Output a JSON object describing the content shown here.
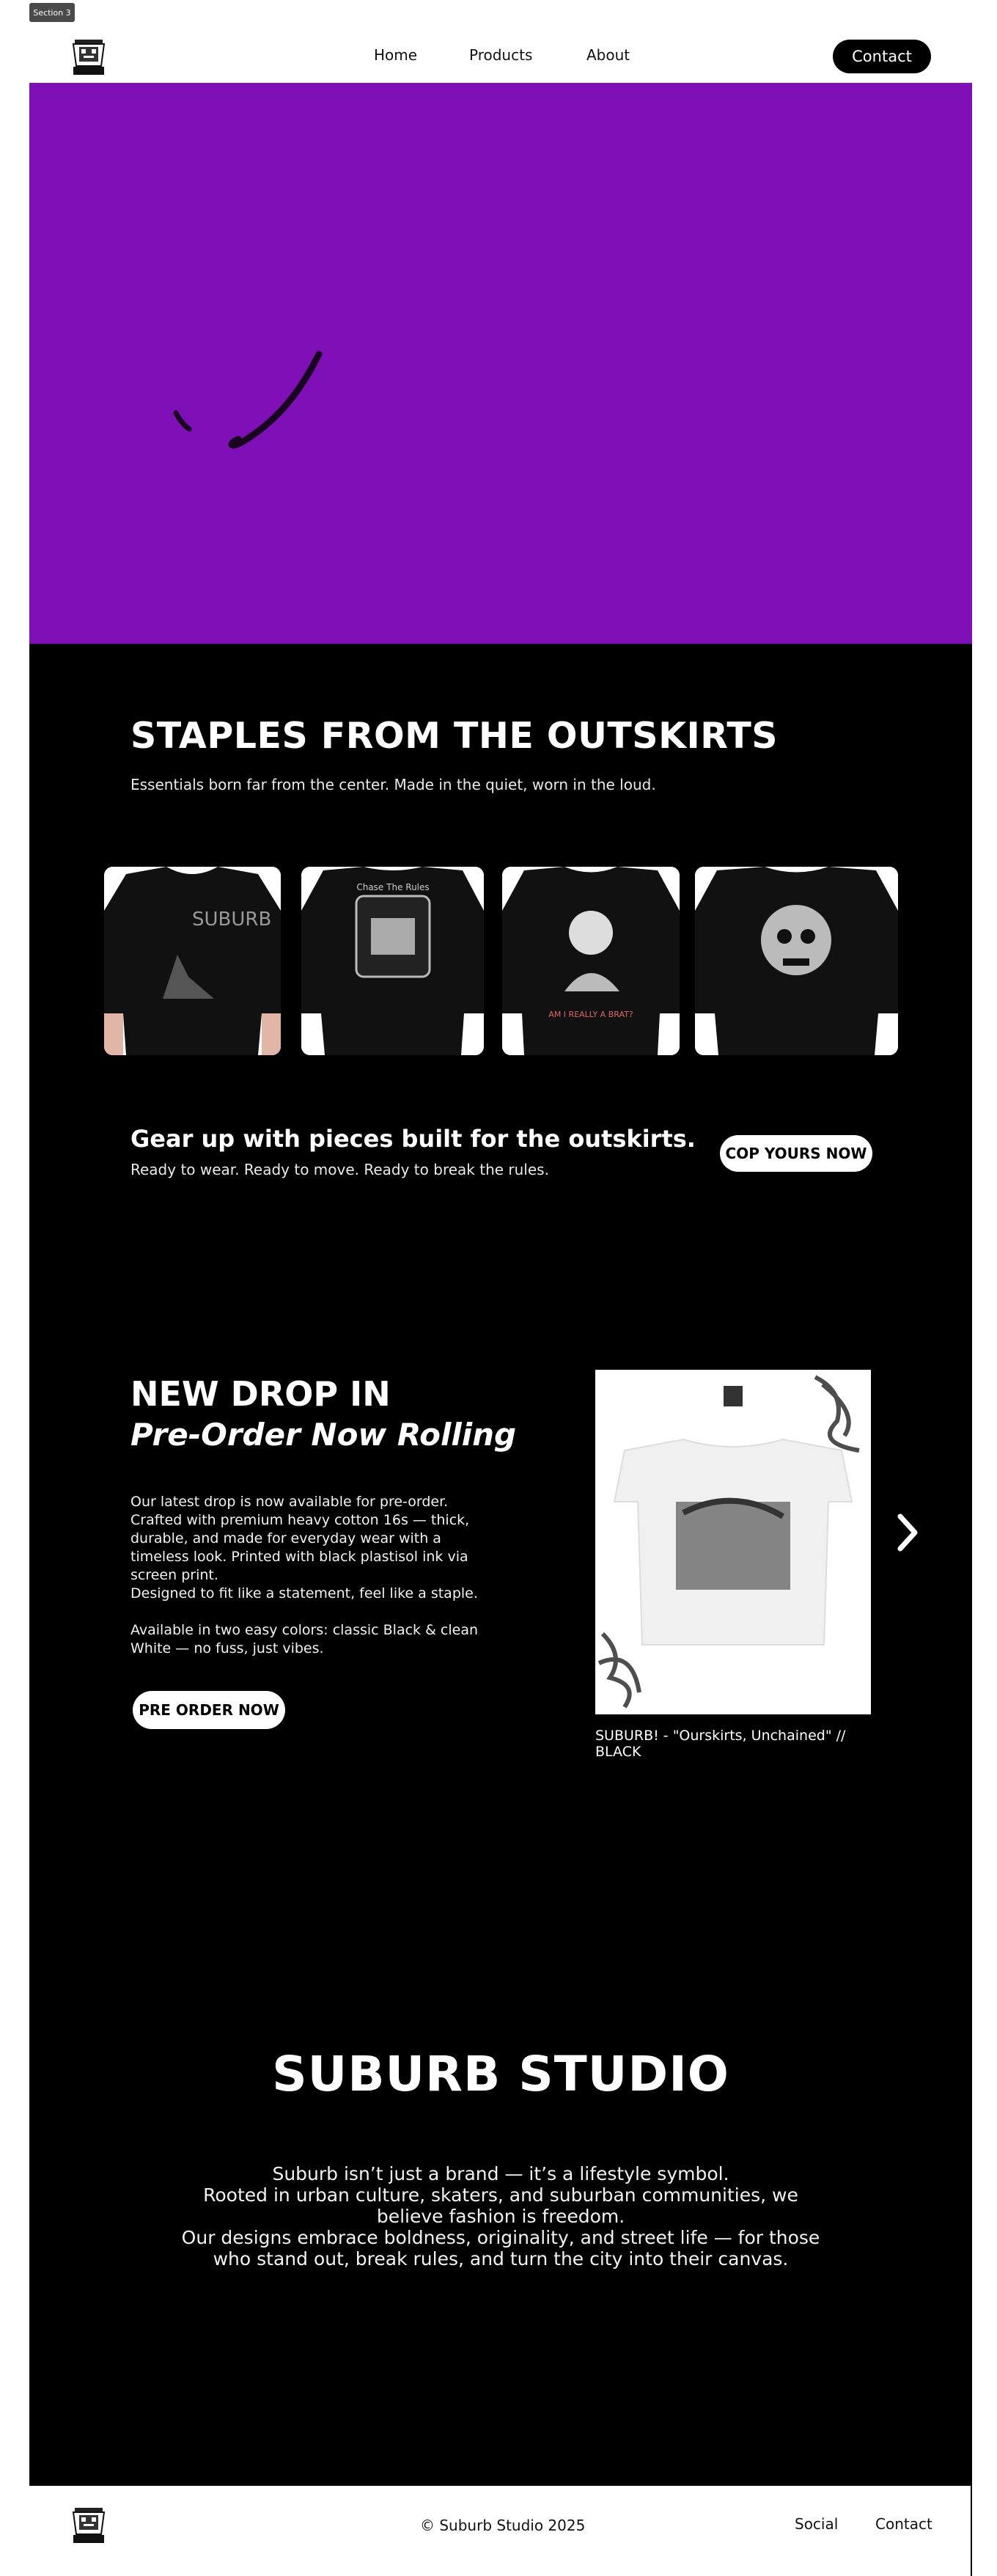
{
  "section_tag": "Section 3",
  "header": {
    "logo_text": "Suburb",
    "nav": {
      "home": "Home",
      "products": "Products",
      "about": "About"
    },
    "contact_label": "Contact"
  },
  "colors": {
    "hero_bg": "#7f0fb7",
    "dark_bg": "#000000",
    "text_light": "#ffffff"
  },
  "staples": {
    "title": "STAPLES FROM THE OUTSKIRTS",
    "subtitle": "Essentials born far from the center. Made in the quiet, worn in the loud."
  },
  "products": [
    {
      "name": "black tee with lawnmower graphic",
      "print_text": "SUBURB"
    },
    {
      "name": "black tee with Chase The Rules graphic",
      "print_text": "Chase The Rules"
    },
    {
      "name": "black tee with character graphic",
      "print_text": "AM I REALLY A BRAT?"
    },
    {
      "name": "black tee with skull graphic"
    }
  ],
  "gear": {
    "title": "Gear up with pieces built for the outskirts.",
    "subtitle": "Ready to wear. Ready to move. Ready to break the rules.",
    "cta_label": "COP YOURS NOW"
  },
  "new_drop": {
    "title": "NEW DROP IN",
    "subtitle": "Pre-Order Now Rolling",
    "description": "Our latest drop is now available for pre-order.\nCrafted with premium heavy cotton 16s — thick,\ndurable, and made for everyday wear with a\ntimeless look. Printed with black plastisol ink via\nscreen print.\nDesigned to fit like a statement, feel like a staple.\n\nAvailable in two easy colors: classic Black & clean\nWhite — no fuss, just vibes.",
    "cta_label": "PRE ORDER NOW",
    "product_caption": "SUBURB! - \"Ourskirts, Unchained\" // BLACK",
    "next_icon": "chevron-right-icon"
  },
  "studio": {
    "brand": "SUBURB STUDIO",
    "text": "Suburb isn’t just a brand — it’s a lifestyle symbol.\nRooted in urban culture, skaters, and suburban communities, we\nbelieve fashion is freedom.\nOur designs embrace boldness, originality, and street life — for those\nwho stand out, break rules, and turn the city into their canvas."
  },
  "footer": {
    "copyright": "© Suburb Studio 2025",
    "social_label": "Social",
    "contact_label": "Contact"
  }
}
